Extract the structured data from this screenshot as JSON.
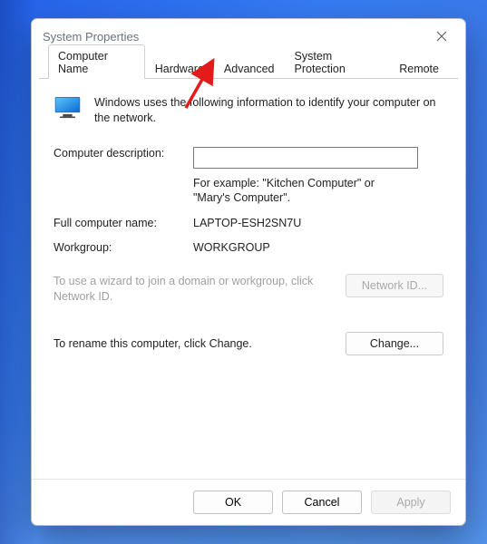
{
  "window": {
    "title": "System Properties"
  },
  "tabs": {
    "computer_name": "Computer Name",
    "hardware": "Hardware",
    "advanced": "Advanced",
    "system_protection": "System Protection",
    "remote": "Remote"
  },
  "body": {
    "intro": "Windows uses the following information to identify your computer on the network.",
    "desc_label": "Computer description:",
    "desc_value": "",
    "example": "For example: \"Kitchen Computer\" or \"Mary's Computer\".",
    "fullname_label": "Full computer name:",
    "fullname_value": "LAPTOP-ESH2SN7U",
    "workgroup_label": "Workgroup:",
    "workgroup_value": "WORKGROUP",
    "wizard_text": "To use a wizard to join a domain or workgroup, click Network ID.",
    "network_id_btn": "Network ID...",
    "rename_text": "To rename this computer, click Change.",
    "change_btn": "Change..."
  },
  "footer": {
    "ok": "OK",
    "cancel": "Cancel",
    "apply": "Apply"
  },
  "annotation": {
    "arrow_color": "#e31b1b"
  }
}
